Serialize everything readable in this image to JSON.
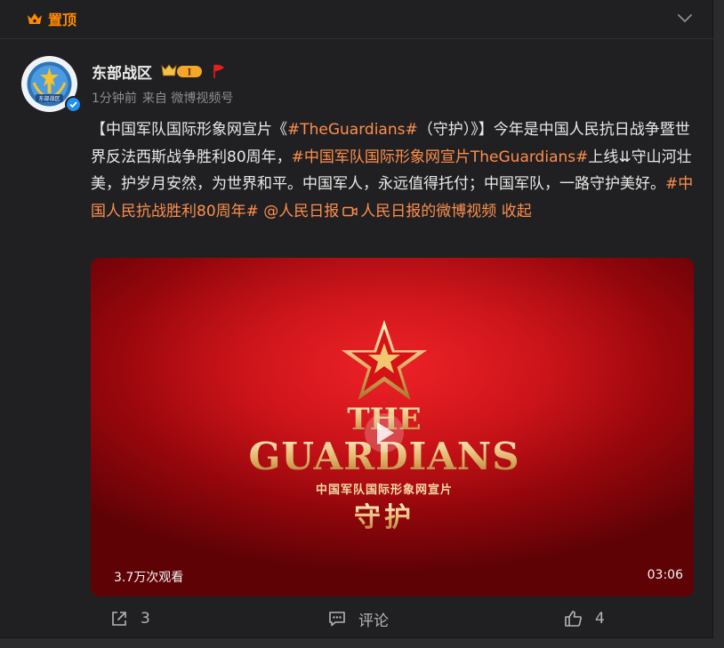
{
  "header": {
    "pinned_label": "置顶"
  },
  "user": {
    "name": "东部战区",
    "level_badge": "I",
    "avatar_text": "东部战区",
    "meta": {
      "time": "1分钟前",
      "source": "来自 微博视频号"
    }
  },
  "post": {
    "segments": [
      {
        "type": "text",
        "value": "【中国军队国际形象网宣片《"
      },
      {
        "type": "hl",
        "value": "#TheGuardians#"
      },
      {
        "type": "text",
        "value": "（守护）》】今年是中国人民抗日战争暨世界反法西斯战争胜利80周年，"
      },
      {
        "type": "hl",
        "value": "#中国军队国际形象网宣片TheGuardians#"
      },
      {
        "type": "text",
        "value": "上线⇊守山河壮美，护岁月安然，为世界和平。中国军人，永远值得托付；中国军队，一路守护美好。"
      },
      {
        "type": "hl",
        "value": "#中国人民抗战胜利80周年#"
      },
      {
        "type": "text",
        "value": " "
      },
      {
        "type": "hl",
        "value": "@人民日报"
      },
      {
        "type": "lnk",
        "value": "人民日报的微博视频"
      },
      {
        "type": "text",
        "value": " "
      },
      {
        "type": "hl",
        "value": "收起"
      }
    ]
  },
  "video": {
    "title_line1": "THE",
    "title_line2": "GUARDIANS",
    "subtitle": "中国军队国际形象网宣片",
    "chinese_title": "守护",
    "views": "3.7万次观看",
    "duration": "03:06"
  },
  "actions": {
    "share": "3",
    "comment": "评论",
    "like": "4"
  },
  "colors": {
    "accent": "#ff8e4c",
    "pinned": "#ff8a00",
    "video_red": "#c30d14",
    "gold": "#e8c98a"
  }
}
